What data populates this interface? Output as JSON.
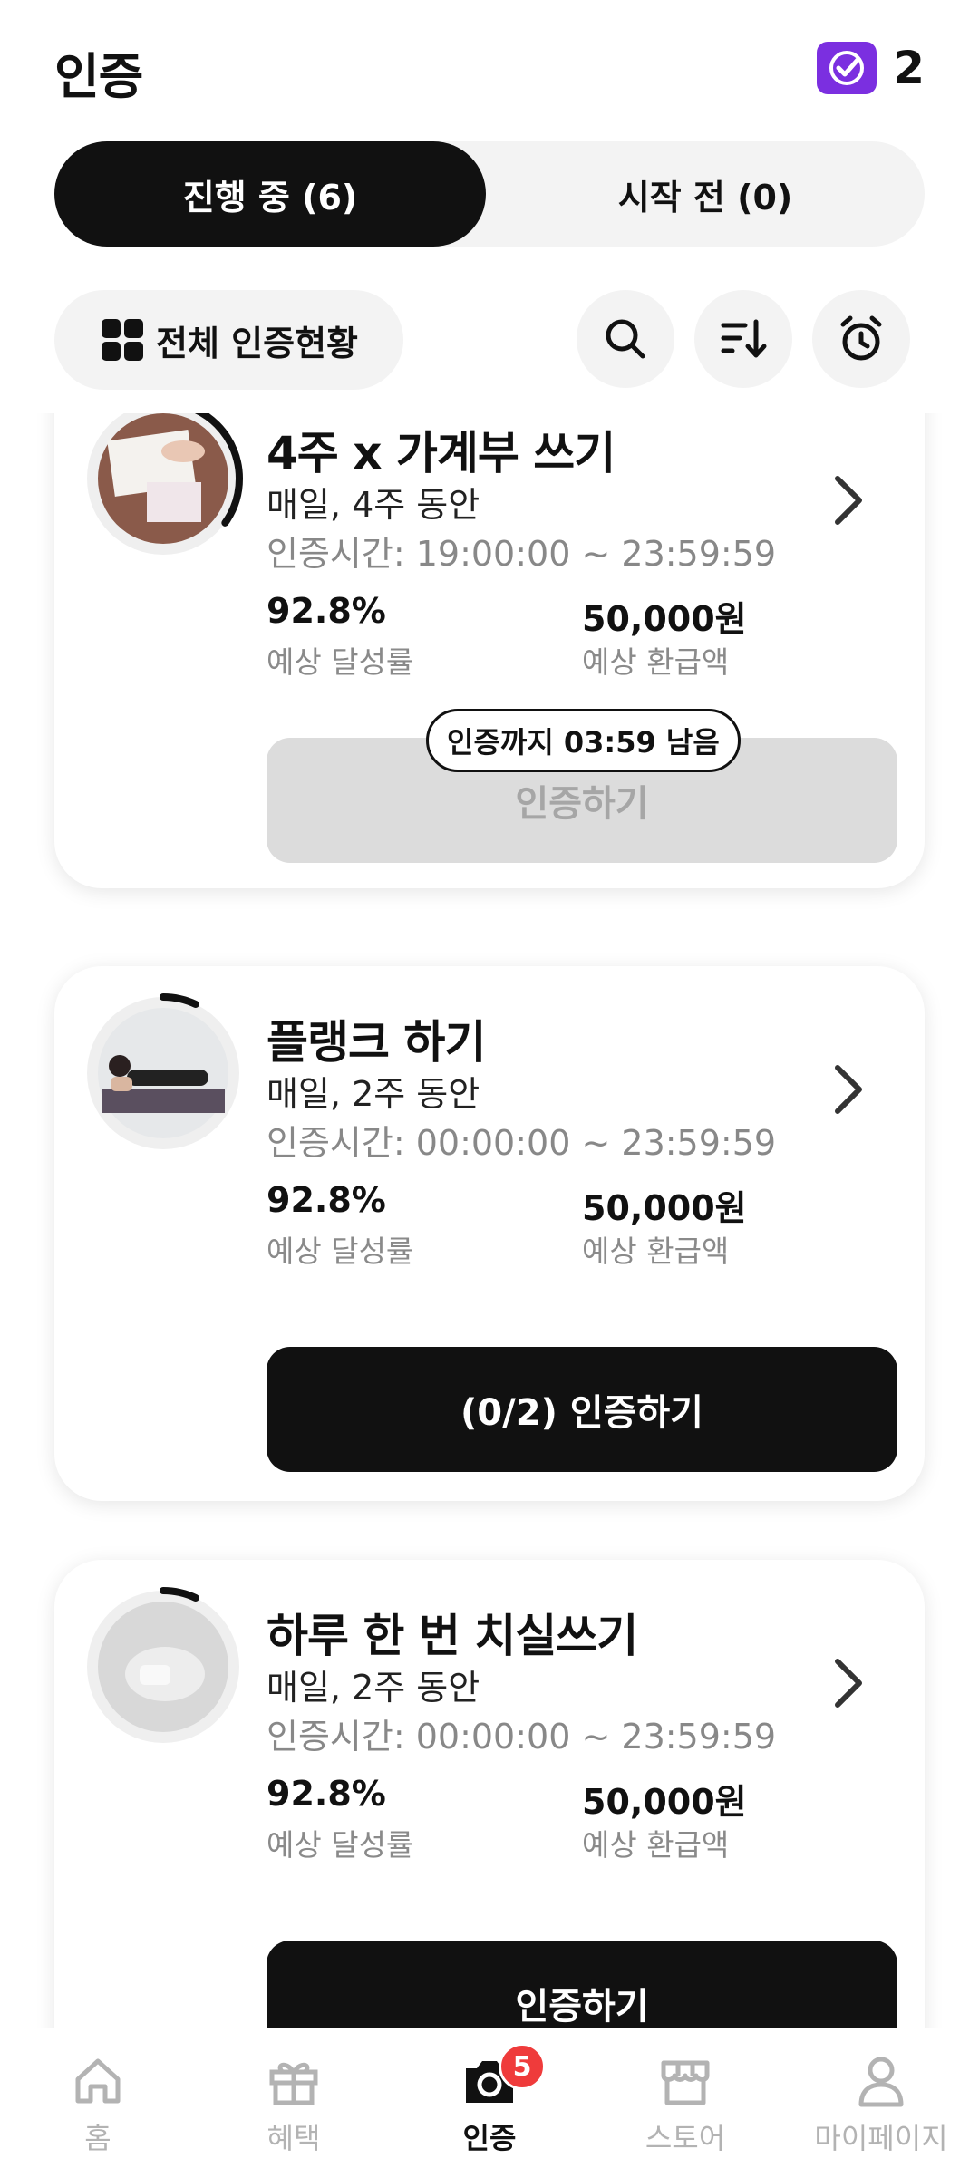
{
  "header": {
    "title": "인증",
    "badge_count": "2",
    "badge_color": "#7b2fe0"
  },
  "tabs": [
    {
      "label": "진행 중 (6)",
      "active": true
    },
    {
      "label": "시작 전 (0)",
      "active": false
    }
  ],
  "toolbar": {
    "all_status_label": "전체 인증현황",
    "icons": [
      "search-icon",
      "sort-icon",
      "alarm-clock-icon"
    ]
  },
  "cards": [
    {
      "title": "4주 x 가계부 쓰기",
      "frequency": "매일, 4주 동안",
      "time": "인증시간: 19:00:00 ~ 23:59:59",
      "rate_value": "92.8%",
      "rate_label": "예상 달성률",
      "refund_value": "50,000원",
      "refund_label": "예상 환급액",
      "timer_label": "인증까지 03:59 남음",
      "cta_label": "인증하기",
      "cta_state": "disabled",
      "progress": 0.35
    },
    {
      "title": "플랭크 하기",
      "frequency": "매일, 2주 동안",
      "time": "인증시간: 00:00:00 ~ 23:59:59",
      "rate_value": "92.8%",
      "rate_label": "예상 달성률",
      "refund_value": "50,000원",
      "refund_label": "예상 환급액",
      "cta_label": "(0/2) 인증하기",
      "cta_state": "active",
      "progress": 0.07
    },
    {
      "title": "하루 한 번 치실쓰기",
      "frequency": "매일, 2주 동안",
      "time": "인증시간: 00:00:00 ~ 23:59:59",
      "rate_value": "92.8%",
      "rate_label": "예상 달성률",
      "refund_value": "50,000원",
      "refund_label": "예상 환급액",
      "cta_label": "인증하기",
      "cta_state": "active",
      "progress": 0.07
    }
  ],
  "bottom_nav": [
    {
      "label": "홈",
      "icon": "home-icon",
      "active": false
    },
    {
      "label": "혜택",
      "icon": "gift-icon",
      "active": false
    },
    {
      "label": "인증",
      "icon": "camera-icon",
      "active": true,
      "badge": "5"
    },
    {
      "label": "스토어",
      "icon": "store-icon",
      "active": false
    },
    {
      "label": "마이페이지",
      "icon": "person-icon",
      "active": false
    }
  ]
}
